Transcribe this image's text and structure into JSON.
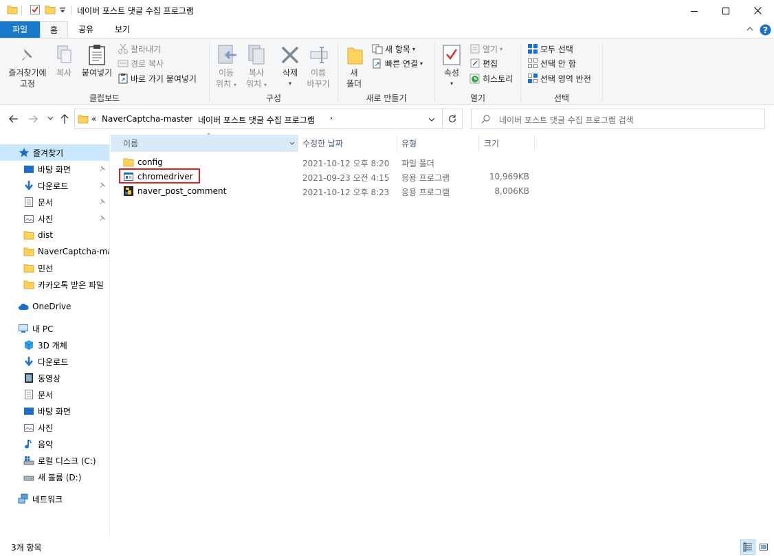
{
  "window": {
    "title": "네이버 포스트 댓글 수집 프로그램",
    "buttons": [
      "minimize",
      "maximize",
      "close"
    ]
  },
  "ribbon_tabs": [
    {
      "label": "파일"
    },
    {
      "label": "홈"
    },
    {
      "label": "공유"
    },
    {
      "label": "보기"
    }
  ],
  "ribbon": {
    "clipboard": {
      "pin_label": "즐겨찾기에\n고정",
      "pin_line1": "즐겨찾기에",
      "pin_line2": "고정",
      "copy_label": "복사",
      "paste_label": "붙여넣기",
      "cut_label": "잘라내기",
      "copy_path_label": "경로 복사",
      "paste_shortcut_label": "바로 가기 붙여넣기",
      "group_label": "클립보드"
    },
    "organize": {
      "move_line1": "이동",
      "move_line2": "위치",
      "copy_line1": "복사",
      "copy_line2": "위치",
      "delete_label": "삭제",
      "rename_line1": "이름",
      "rename_line2": "바꾸기",
      "group_label": "구성"
    },
    "new": {
      "new_folder_line1": "새",
      "new_folder_line2": "폴더",
      "new_item_label": "새 항목",
      "easy_access_label": "빠른 연결",
      "group_label": "새로 만들기"
    },
    "open": {
      "properties_label": "속성",
      "open_label": "열기",
      "edit_label": "편집",
      "history_label": "히스토리",
      "group_label": "열기"
    },
    "select": {
      "select_all_label": "모두 선택",
      "select_none_label": "선택 안 함",
      "invert_label": "선택 영역 반전",
      "group_label": "선택"
    }
  },
  "address": {
    "overflow": "«",
    "crumbs": [
      "NaverCaptcha-master",
      "네이버 포스트 댓글 수집 프로그램"
    ],
    "search_placeholder": "네이버 포스트 댓글 수집 프로그램 검색"
  },
  "nav": {
    "quick_access": {
      "label": "즐겨찾기",
      "items": [
        {
          "label": "바탕 화면",
          "pinned": true
        },
        {
          "label": "다운로드",
          "pinned": true
        },
        {
          "label": "문서",
          "pinned": true
        },
        {
          "label": "사진",
          "pinned": true
        },
        {
          "label": "dist",
          "pinned": false
        },
        {
          "label": "NaverCaptcha-mast",
          "pinned": false
        },
        {
          "label": "민선",
          "pinned": false
        },
        {
          "label": "카카오톡 받은 파일",
          "pinned": false
        }
      ]
    },
    "onedrive": {
      "label": "OneDrive"
    },
    "this_pc": {
      "label": "내 PC",
      "items": [
        {
          "label": "3D 개체"
        },
        {
          "label": "다운로드"
        },
        {
          "label": "동영상"
        },
        {
          "label": "문서"
        },
        {
          "label": "바탕 화면"
        },
        {
          "label": "사진"
        },
        {
          "label": "음악"
        },
        {
          "label": "로컬 디스크 (C:)"
        },
        {
          "label": "새 볼륨 (D:)"
        }
      ]
    },
    "network": {
      "label": "네트워크"
    }
  },
  "columns": {
    "name": "이름",
    "date": "수정한 날짜",
    "type": "유형",
    "size": "크기"
  },
  "files": [
    {
      "name": "config",
      "date": "2021-10-12 오후 8:20",
      "type": "파일 폴더",
      "size": "",
      "icon": "folder-icon"
    },
    {
      "name": "chromedriver",
      "date": "2021-09-23 오전 4:15",
      "type": "응용 프로그램",
      "size": "10,969KB",
      "icon": "app-window-icon",
      "highlighted": true
    },
    {
      "name": "naver_post_comment",
      "date": "2021-10-12 오후 8:23",
      "type": "응용 프로그램",
      "size": "8,006KB",
      "icon": "python-app-icon"
    }
  ],
  "status": {
    "item_count": "3개 항목"
  },
  "colors": {
    "accent": "#1979ca",
    "selected": "#cce8ff",
    "highlight_border": "#e02020",
    "folder": "#ffd35c"
  }
}
